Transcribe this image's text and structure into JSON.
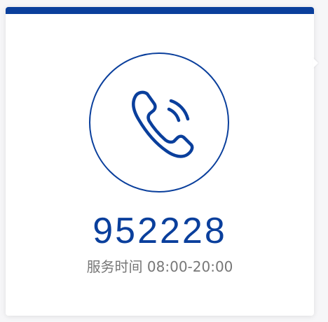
{
  "contact_card": {
    "phone_number": "952228",
    "service_hours": "服务时间 08:00-20:00",
    "accent_color": "#0a3f9c",
    "icon": "phone-call-icon"
  }
}
